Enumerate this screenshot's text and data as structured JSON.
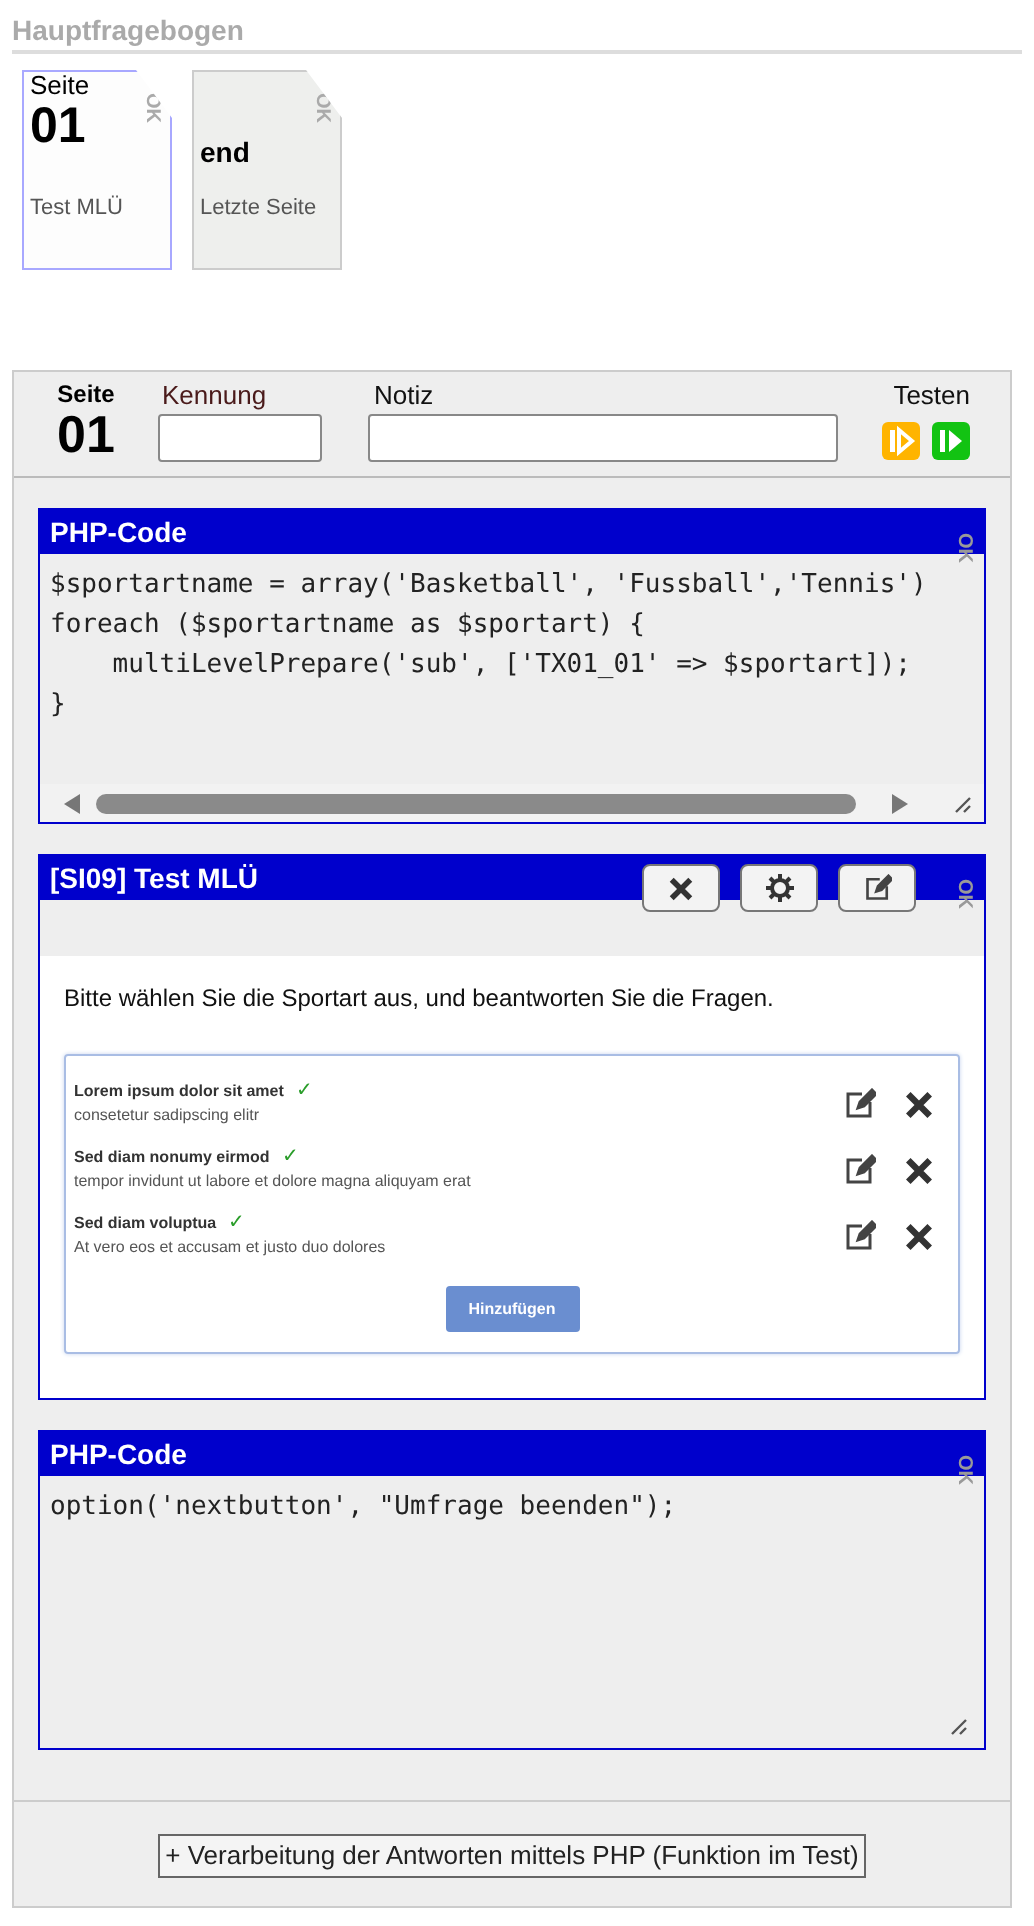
{
  "header": {
    "title": "Hauptfragebogen"
  },
  "pages": [
    {
      "label": "Seite",
      "number": "01",
      "name": "Test MLÜ",
      "ok": "OK",
      "selected": true
    },
    {
      "number": "end",
      "name": "Letzte Seite",
      "ok": "OK",
      "selected": false
    }
  ],
  "page_editor": {
    "seite_label": "Seite",
    "number": "01",
    "kennung_label": "Kennung",
    "notiz_label": "Notiz",
    "testen_label": "Testen"
  },
  "blocks": [
    {
      "kind": "php",
      "title": "PHP-Code",
      "ok": "OK",
      "scrollbar": true,
      "code": [
        "$sportartname = array('Basketball', 'Fussball','Tennis')",
        "foreach ($sportartname as $sportart) {",
        "    multiLevelPrepare('sub', ['TX01_01' => $sportart]);",
        "}"
      ]
    },
    {
      "kind": "question",
      "title": "[SI09] Test MLÜ",
      "ok": "OK",
      "intro": "Bitte wählen Sie die Sportart aus, und beantworten Sie die Fragen.",
      "add_button": "Hinzufügen",
      "items": [
        {
          "title": "Lorem ipsum dolor sit amet",
          "mark": "✓",
          "subtitle": "consetetur sadipscing elitr"
        },
        {
          "title": "Sed diam nonumy eirmod",
          "mark": "✓",
          "subtitle": "tempor invidunt ut labore et dolore magna aliquyam erat"
        },
        {
          "title": "Sed diam voluptua",
          "mark": "✓",
          "subtitle": "At vero eos et accusam et justo duo dolores"
        }
      ]
    },
    {
      "kind": "php",
      "title": "PHP-Code",
      "ok": "OK",
      "scrollbar": false,
      "code": [
        "option('nextbutton', \"Umfrage beenden\");"
      ]
    }
  ],
  "footer_button": "+ Verarbeitung der Antworten mittels PHP (Funktion im Test)"
}
